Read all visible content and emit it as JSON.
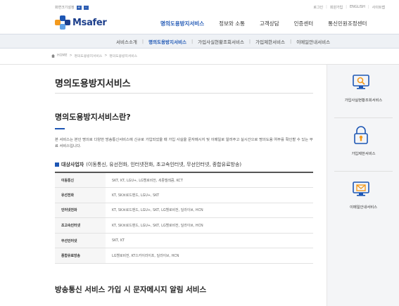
{
  "utility": {
    "zoom_label": "화면크기설정",
    "zoom_in": "+",
    "zoom_out": "-",
    "links": [
      "로그인",
      "회원가입",
      "ENGLISH",
      "사이트맵"
    ]
  },
  "brand": {
    "name": "Msafer",
    "colors": {
      "accent": "#1d56b4",
      "orange": "#f39a1e",
      "navy": "#1d3f8c"
    }
  },
  "gnb": {
    "items": [
      "명의도용방지서비스",
      "정보와 소통",
      "고객상담",
      "인증센터",
      "통신민원조정센터"
    ],
    "active_index": 0
  },
  "subnav": {
    "items": [
      "서비스소개",
      "명의도용방지서비스",
      "가입사실현황조회서비스",
      "가입제한서비스",
      "이메일안내서비스"
    ],
    "active_index": 1
  },
  "breadcrumb": [
    "HOME",
    "명의도용방지서비스",
    "명의도용방지서비스"
  ],
  "page": {
    "title": "명의도용방지서비스",
    "section_title": "명의도용방지서비스란?",
    "description": "본 서비스는 본인 명의로 다양한 방송통신서비스에 신규로 가입되었을 때 가입 사실을 문자메시지 및 이메일로 알려주고 실시간으로 명의도용 여부를 확인할 수 있는 무료 서비스입니다.",
    "target_label": "대상사업자",
    "target_text": "(이동통신, 유선전화, 인터넷전화, 초고속인터넷, 무선인터넷, 종합유료방송)",
    "table": [
      {
        "key": "이동통신",
        "value": "SKT, KT, LGU+, LG헬로비전, 세종텔레콤, KCT"
      },
      {
        "key": "유선전화",
        "value": "KT, SK브로드밴드, LGU+, SKT"
      },
      {
        "key": "인터넷전화",
        "value": "KT, SK브로드밴드, LGU+, SKT, LG헬로비전, 딜라이브, HCN"
      },
      {
        "key": "초고속인터넷",
        "value": "KT, SK브로드밴드, LGU+, SKT, LG헬로비전, 딜라이브, HCN"
      },
      {
        "key": "무선인터넷",
        "value": "SKT, KT"
      },
      {
        "key": "종합유료방송",
        "value": "LG헬로비전, KT스카이라이프, 딜라이브, HCN"
      }
    ],
    "section3_title": "방송통신 서비스 가입 시 문자메시지 알림 서비스"
  },
  "quick": [
    {
      "label": "가입사실현황조회서비스",
      "icon": "monitor-search-icon"
    },
    {
      "label": "가입제한서비스",
      "icon": "lock-user-icon"
    },
    {
      "label": "이메일안내서비스",
      "icon": "monitor-mail-icon"
    }
  ]
}
